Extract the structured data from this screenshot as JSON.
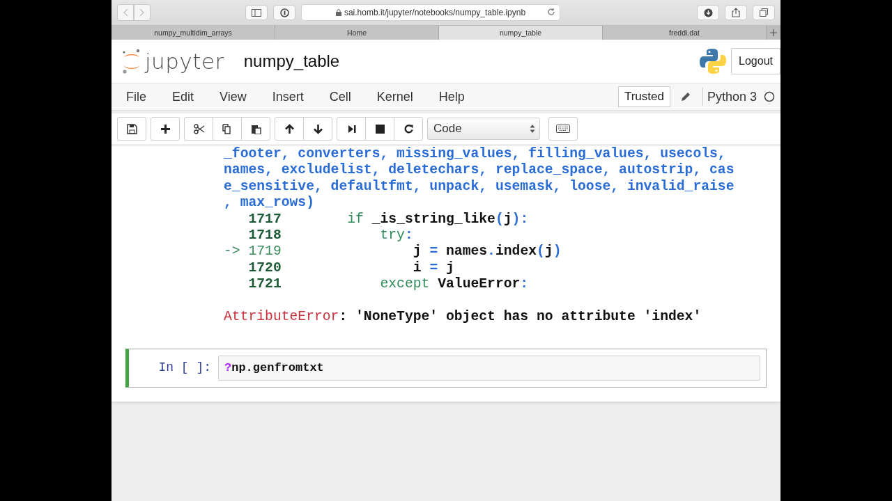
{
  "browser": {
    "back_disabled": true,
    "forward_disabled": true,
    "url": "sai.homb.it/jupyter/notebooks/numpy_table.ipynb",
    "tabs": [
      {
        "label": "numpy_multidim_arrays",
        "selected": false
      },
      {
        "label": "Home",
        "selected": false
      },
      {
        "label": "numpy_table",
        "selected": true
      },
      {
        "label": "freddi.dat",
        "selected": false
      }
    ]
  },
  "header": {
    "logo_text": "jupyter",
    "notebook_name": "numpy_table",
    "logout": "Logout"
  },
  "menubar": {
    "menus": [
      "File",
      "Edit",
      "View",
      "Insert",
      "Cell",
      "Kernel",
      "Help"
    ],
    "trusted": "Trusted",
    "kernel": "Python 3",
    "kernel_busy": false
  },
  "toolbar": {
    "cell_type": "Code"
  },
  "output": {
    "signature_lines": [
      "_footer, converters, missing_values, filling_values, usecols,",
      "names, excludelist, deletechars, replace_space, autostrip, cas",
      "e_sensitive, defaultfmt, unpack, usemask, loose, invalid_raise",
      ", max_rows)"
    ],
    "source_lines": [
      {
        "number": "1717",
        "current": false,
        "code": [
          {
            "kind": "keyword",
            "text": "        if"
          },
          {
            "kind": "name",
            "text": " _is_string_like"
          },
          {
            "kind": "punct",
            "text": "("
          },
          {
            "kind": "name",
            "text": "j"
          },
          {
            "kind": "punct",
            "text": "):"
          }
        ]
      },
      {
        "number": "1718",
        "current": false,
        "code": [
          {
            "kind": "keyword",
            "text": "            try"
          },
          {
            "kind": "punct",
            "text": ":"
          }
        ]
      },
      {
        "marker": "->",
        "number": "1719",
        "current": true,
        "code": [
          {
            "kind": "name",
            "text": "                j "
          },
          {
            "kind": "punct",
            "text": "="
          },
          {
            "kind": "name",
            "text": " names"
          },
          {
            "kind": "punct",
            "text": "."
          },
          {
            "kind": "name",
            "text": "index"
          },
          {
            "kind": "punct",
            "text": "("
          },
          {
            "kind": "name",
            "text": "j"
          },
          {
            "kind": "punct",
            "text": ")"
          }
        ]
      },
      {
        "number": "1720",
        "current": false,
        "code": [
          {
            "kind": "name",
            "text": "                i "
          },
          {
            "kind": "punct",
            "text": "="
          },
          {
            "kind": "name",
            "text": " j"
          }
        ]
      },
      {
        "number": "1721",
        "current": false,
        "code": [
          {
            "kind": "keyword",
            "text": "            except"
          },
          {
            "kind": "name",
            "text": " ValueError"
          },
          {
            "kind": "punct",
            "text": ":"
          }
        ]
      }
    ],
    "error_name": "AttributeError",
    "error_message": ": 'NoneType' object has no attribute 'index'"
  },
  "cell": {
    "prompt": "In [ ]:",
    "selected": true,
    "input": [
      {
        "kind": "operator",
        "text": "?"
      },
      {
        "kind": "name",
        "text": "np.genfromtxt"
      }
    ]
  }
}
